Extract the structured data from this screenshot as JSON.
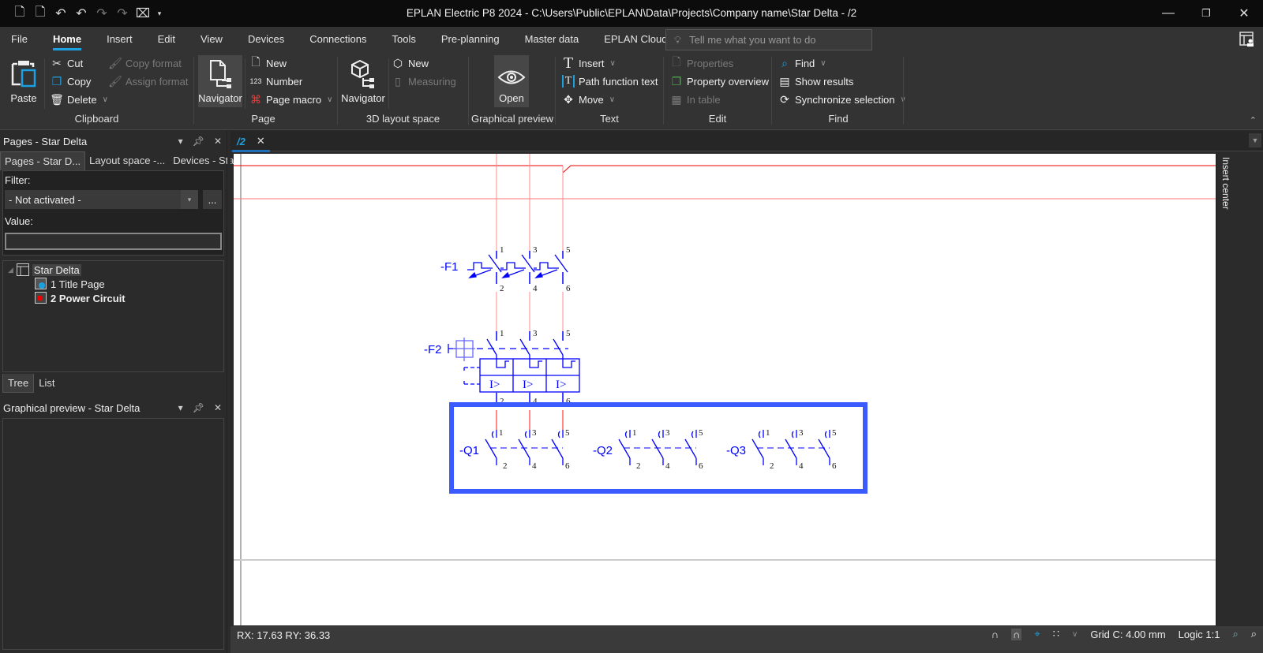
{
  "window": {
    "title": "EPLAN Electric P8 2024 - C:\\Users\\Public\\EPLAN\\Data\\Projects\\Company name\\Star Delta - /2",
    "quick_access": [
      "new-project-icon",
      "open-project-icon",
      "undo-page-icon",
      "undo-icon",
      "redo-icon",
      "redo-page-icon",
      "close-project-icon",
      "customize-dropdown-icon"
    ],
    "controls": {
      "minimize": "minimize-icon",
      "restore": "restore-icon",
      "close": "close-icon"
    }
  },
  "ribbon_tabs": [
    {
      "label": "File",
      "active": false
    },
    {
      "label": "Home",
      "active": true
    },
    {
      "label": "Insert",
      "active": false
    },
    {
      "label": "Edit",
      "active": false
    },
    {
      "label": "View",
      "active": false
    },
    {
      "label": "Devices",
      "active": false
    },
    {
      "label": "Connections",
      "active": false
    },
    {
      "label": "Tools",
      "active": false
    },
    {
      "label": "Pre-planning",
      "active": false
    },
    {
      "label": "Master data",
      "active": false
    },
    {
      "label": "EPLAN Cloud",
      "active": false
    }
  ],
  "tellme": {
    "placeholder": "Tell me what you want to do"
  },
  "ribbon": {
    "clipboard": {
      "label": "Clipboard",
      "paste": "Paste",
      "cut": "Cut",
      "copy": "Copy",
      "delete": "Delete",
      "copy_format": "Copy format",
      "assign_format": "Assign format"
    },
    "page": {
      "label": "Page",
      "navigator": "Navigator",
      "new": "New",
      "number": "Number",
      "page_macro": "Page macro"
    },
    "layout3d": {
      "label": "3D layout space",
      "navigator": "Navigator",
      "new": "New",
      "measuring": "Measuring"
    },
    "graphical_preview": {
      "label": "Graphical preview",
      "open": "Open"
    },
    "text": {
      "label": "Text",
      "insert": "Insert",
      "path_function_text": "Path function text",
      "move": "Move"
    },
    "edit": {
      "label": "Edit",
      "properties": "Properties",
      "property_overview": "Property overview",
      "in_table": "In table"
    },
    "find": {
      "label": "Find",
      "find": "Find",
      "show_results": "Show results",
      "synchronize_selection": "Synchronize selection"
    }
  },
  "pages_panel": {
    "title": "Pages - Star Delta",
    "tabs": [
      "Pages - Star D...",
      "Layout space -...",
      "Devices - Star ..."
    ],
    "filter_label": "Filter:",
    "filter_value": "- Not activated -",
    "filter_more": "...",
    "value_label": "Value:",
    "value_input": "",
    "tree": {
      "root": "Star Delta",
      "children": [
        {
          "label": "1 Title Page",
          "bold": false
        },
        {
          "label": "2 Power Circuit",
          "bold": true
        }
      ]
    },
    "bottom_tabs": [
      "Tree",
      "List"
    ]
  },
  "preview_panel": {
    "title": "Graphical preview - Star Delta"
  },
  "document": {
    "tab": "/2",
    "insert_center": "Insert center",
    "schematic": {
      "devices": [
        {
          "tag": "-F1",
          "type": "motor protection switch",
          "terminals_top": [
            "1",
            "3",
            "5"
          ],
          "terminals_bottom": [
            "2",
            "4",
            "6"
          ]
        },
        {
          "tag": "-F2",
          "type": "circuit breaker",
          "terminals_top": [
            "1",
            "3",
            "5"
          ],
          "terminals_bottom": [
            "2",
            "4",
            "6"
          ],
          "trip_labels": [
            "I>",
            "I>",
            "I>"
          ]
        },
        {
          "tag": "-Q1",
          "type": "contactor",
          "terminals_top": [
            "1",
            "3",
            "5"
          ],
          "terminals_bottom": [
            "2",
            "4",
            "6"
          ]
        },
        {
          "tag": "-Q2",
          "type": "contactor",
          "terminals_top": [
            "1",
            "3",
            "5"
          ],
          "terminals_bottom": [
            "2",
            "4",
            "6"
          ]
        },
        {
          "tag": "-Q3",
          "type": "contactor",
          "terminals_top": [
            "1",
            "3",
            "5"
          ],
          "terminals_bottom": [
            "2",
            "4",
            "6"
          ]
        }
      ],
      "colors": {
        "wire": "#e00000",
        "symbol": "#0000ff",
        "selection": "#3b5bff"
      }
    }
  },
  "statusbar": {
    "coords": "RX: 17.63 RY: 36.33",
    "grid": "Grid C: 4.00 mm",
    "logic": "Logic 1:1"
  }
}
